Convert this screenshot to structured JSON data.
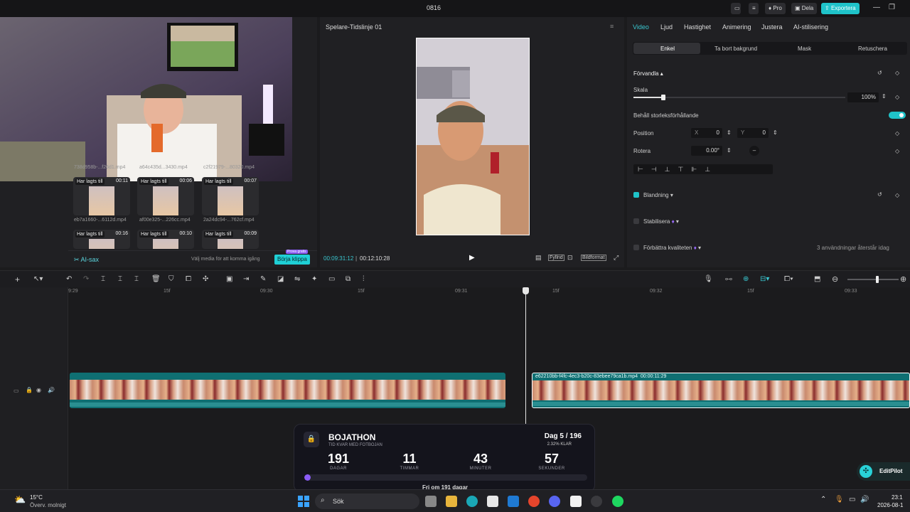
{
  "window": {
    "title": "0816",
    "pro_label": "Pro",
    "share_label": "Dela",
    "export_label": "Exportera"
  },
  "media": {
    "items": [
      {
        "badge": "Har lagts till",
        "duration": "00:11",
        "name": "eb7a1660-...6112d.mp4"
      },
      {
        "badge": "Har lagts till",
        "duration": "00:06",
        "name": "af00e325-...226cc.mp4"
      },
      {
        "badge": "Har lagts till",
        "duration": "00:07",
        "name": "2a24dc94-...762cf.mp4"
      },
      {
        "badge": "Har lagts till",
        "duration": "00:16",
        "name": ""
      },
      {
        "badge": "Har lagts till",
        "duration": "00:10",
        "name": ""
      },
      {
        "badge": "Har lagts till",
        "duration": "00:09",
        "name": ""
      }
    ],
    "top_names": [
      "738d958b-...f26d1.mp4",
      "a64c435d...3430.mp4",
      "c2f21979-...80320.mp4"
    ],
    "ai_label": "AI-sax",
    "hint": "Välj media för att komma igång",
    "start_button": "Börja klippa",
    "free_badge": "Prova gratis"
  },
  "player": {
    "title": "Spelare-Tidslinje 01",
    "current_time": "00:09:31:12",
    "total_time": "00:12:10:28",
    "fit_label": "Fyllnd",
    "ratio_label": "Bildformat"
  },
  "inspector": {
    "tabs": [
      "Video",
      "Ljud",
      "Hastighet",
      "Animering",
      "Justera",
      "AI-stilisering"
    ],
    "subtabs": [
      "Enkel",
      "Ta bort bakgrund",
      "Mask",
      "Retuschera"
    ],
    "transform_label": "Förvandla",
    "scale_label": "Skala",
    "scale_value": "100%",
    "scale_fraction": 0.14,
    "keep_ratio_label": "Behåll storleksförhållande",
    "position_label": "Position",
    "x_label": "X",
    "x_value": "0",
    "y_label": "Y",
    "y_value": "0",
    "rotate_label": "Rotera",
    "rotate_value": "0.00°",
    "blend_label": "Blandning",
    "stabilize_label": "Stabilisera",
    "enhance_label": "Förbättra kvaliteten",
    "uses_left": "3 användningar återstår idag"
  },
  "timeline": {
    "ruler": [
      "9:29",
      "15f",
      "09:30",
      "15f",
      "09:31",
      "15f",
      "09:32",
      "15f",
      "09:33"
    ],
    "clip2_name": "e62210bb-f4fc-4ec3-b20c-83ebee79ca1b.mp4",
    "clip2_duration": "00:00:11:29"
  },
  "bojathon": {
    "title": "BOJATHON",
    "subtitle": "TID KVAR MED FOTBOJAN",
    "day": "Dag 5 / 196",
    "percent": "2.32% KLAR",
    "progress": 0.0232,
    "units": [
      {
        "value": "191",
        "label": "DAGAR"
      },
      {
        "value": "11",
        "label": "TIMMAR"
      },
      {
        "value": "43",
        "label": "MINUTER"
      },
      {
        "value": "57",
        "label": "SEKUNDER"
      }
    ],
    "footer": "Fri om 191 dagar"
  },
  "editpilot": {
    "label": "EditPilot"
  },
  "taskbar": {
    "temp": "15°C",
    "weather": "Överv. molnigt",
    "search_placeholder": "Sök",
    "time": "23:1",
    "date": "2026-08-1"
  }
}
